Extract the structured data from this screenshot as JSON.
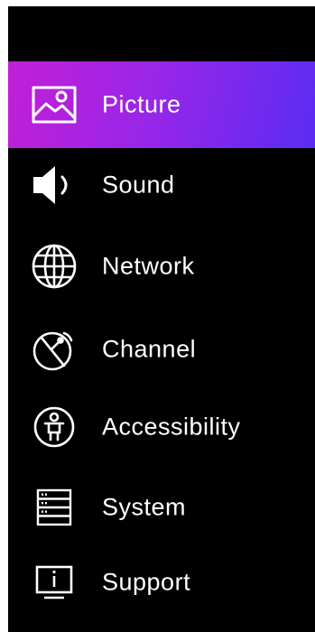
{
  "menu": {
    "items": [
      {
        "label": "Picture",
        "icon": "picture-icon",
        "selected": true
      },
      {
        "label": "Sound",
        "icon": "speaker-icon",
        "selected": false
      },
      {
        "label": "Network",
        "icon": "globe-icon",
        "selected": false
      },
      {
        "label": "Channel",
        "icon": "satellite-dish-icon",
        "selected": false
      },
      {
        "label": "Accessibility",
        "icon": "accessibility-icon",
        "selected": false
      },
      {
        "label": "System",
        "icon": "server-icon",
        "selected": false
      },
      {
        "label": "Support",
        "icon": "info-monitor-icon",
        "selected": false
      }
    ]
  },
  "colors": {
    "background": "#000000",
    "text": "#ffffff",
    "selected_gradient_start": "#c21fd6",
    "selected_gradient_end": "#5a2cf2"
  }
}
